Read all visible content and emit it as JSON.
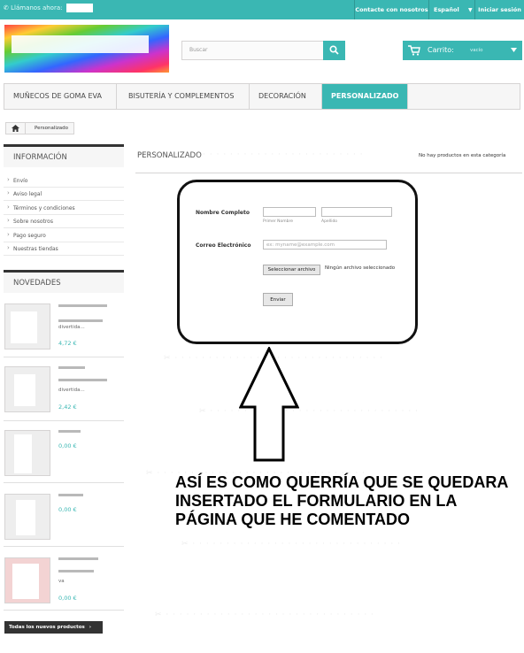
{
  "topbar": {
    "phone_label": "Llámanos ahora:",
    "links": [
      "Contacte con nosotros",
      "Español",
      "Iniciar sesión"
    ]
  },
  "header": {
    "search_placeholder": "Buscar",
    "cart_label": "Carrito:",
    "cart_value": "vacío"
  },
  "menu": {
    "items": [
      "MUÑECOS DE GOMA EVA",
      "BISUTERÍA Y COMPLEMENTOS",
      "DECORACIÓN",
      "PERSONALIZADO"
    ],
    "active": "PERSONALIZADO"
  },
  "breadcrumb": {
    "current": "Personalizado"
  },
  "sidebar": {
    "info_title": "INFORMACIÓN",
    "info_items": [
      "Envío",
      "Aviso legal",
      "Términos y condiciones",
      "Sobre nosotros",
      "Pago seguro",
      "Nuestras tiendas"
    ],
    "new_title": "NOVEDADES",
    "products": [
      {
        "desc": "divertida...",
        "price": "4,72 €"
      },
      {
        "desc": "divertida...",
        "price": "2,42 €"
      },
      {
        "desc": "",
        "price": "0,00 €"
      },
      {
        "desc": "",
        "price": "0,00 €"
      },
      {
        "desc": "va",
        "price": "0,00 €"
      }
    ],
    "all_new_button": "Todas los nuevos productos"
  },
  "main": {
    "heading": "PERSONALIZADO",
    "no_products": "No hay productos en esta categoría",
    "form": {
      "name_label": "Nombre Completo",
      "first_name_hint": "Primer Nombre",
      "last_name_hint": "Apellido",
      "email_label": "Correo Electrónico",
      "email_placeholder": "ex: myname@example.com",
      "file_button": "Seleccionar archivo",
      "file_status": "Ningún archivo seleccionado",
      "submit": "Enviar"
    },
    "annotation": "ASÍ ES COMO QUERRÍA QUE SE QUEDARA INSERTADO EL FORMULARIO EN LA PÁGINA QUE HE COMENTADO"
  },
  "colors": {
    "accent": "#3ab7b3",
    "dark": "#333333"
  }
}
